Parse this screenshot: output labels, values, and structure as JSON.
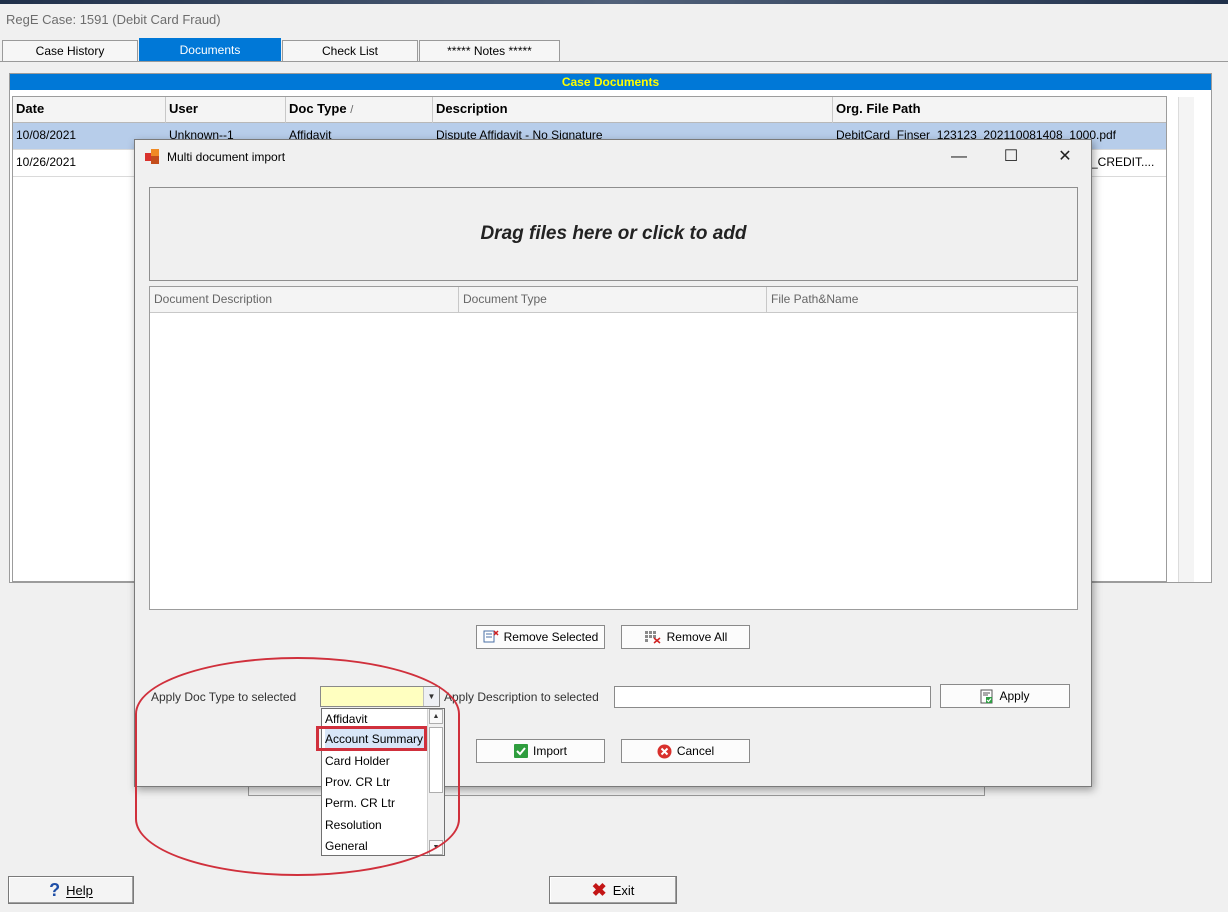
{
  "window": {
    "title": "RegE Case: 1591 (Debit Card Fraud)"
  },
  "tabs": [
    {
      "label": "Case History",
      "active": false
    },
    {
      "label": "Documents",
      "active": true
    },
    {
      "label": "Check List",
      "active": false
    },
    {
      "label": "***** Notes *****",
      "active": false
    }
  ],
  "case_documents": {
    "header": "Case Documents",
    "columns": [
      "Date",
      "User",
      "Doc Type",
      "Description",
      "Org. File Path"
    ],
    "sort_indicator": "/",
    "rows": [
      {
        "date": "10/08/2021",
        "user": "Unknown--1",
        "doc_type": "Affidavit",
        "description": "Dispute Affidavit - No Signature",
        "path": "DebitCard_Finser_123123_202110081408_1000.pdf",
        "selected": true
      },
      {
        "date": "10/26/2021",
        "user": "",
        "doc_type": "",
        "description": "",
        "path": "_CREDIT....",
        "selected": false
      }
    ]
  },
  "dialog": {
    "title": "Multi document import",
    "controls": {
      "minimize": "—",
      "maximize": "☐",
      "close": "✕"
    },
    "dropzone_text": "Drag files here or click to add",
    "grid_columns": [
      "Document Description",
      "Document Type",
      "File Path&Name"
    ],
    "remove_selected_label": "Remove Selected",
    "remove_all_label": "Remove All",
    "apply_doctype_label": "Apply Doc Type to selected",
    "apply_description_label": "Apply Description to selected",
    "doc_type_value": "",
    "description_value": "",
    "apply_label": "Apply",
    "import_label": "Import",
    "cancel_label": "Cancel",
    "dropdown_options": [
      "Affidavit",
      "Account Summary",
      "Card Holder",
      "Prov. CR Ltr",
      "Perm. CR Ltr",
      "Resolution",
      "General"
    ],
    "highlighted_option": "Account Summary"
  },
  "footer": {
    "help_label": "Help",
    "exit_label": "Exit"
  },
  "colors": {
    "accent": "#0078d7",
    "header_text": "#ffff00",
    "selection": "#b7cdea",
    "annotation": "#d0303c",
    "combo_bg": "#ffffc0"
  }
}
